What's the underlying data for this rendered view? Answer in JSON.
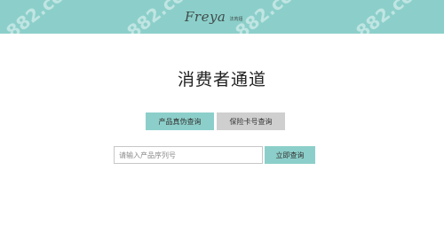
{
  "header": {
    "logo_text": "Freya",
    "logo_sub": "法芮娅",
    "watermarks": [
      "882.cc",
      "882.cc",
      "882.cc",
      "882.cc"
    ]
  },
  "main": {
    "title": "消费者通道",
    "tabs": [
      {
        "label": "产品真伪查询",
        "active": true
      },
      {
        "label": "保险卡号查询",
        "active": false
      }
    ],
    "search": {
      "placeholder": "请输入产品序列号",
      "value": "",
      "button_label": "立即查询"
    }
  },
  "colors": {
    "accent": "#8ccfca",
    "inactive_tab": "#cfcfcf",
    "text": "#222222"
  }
}
